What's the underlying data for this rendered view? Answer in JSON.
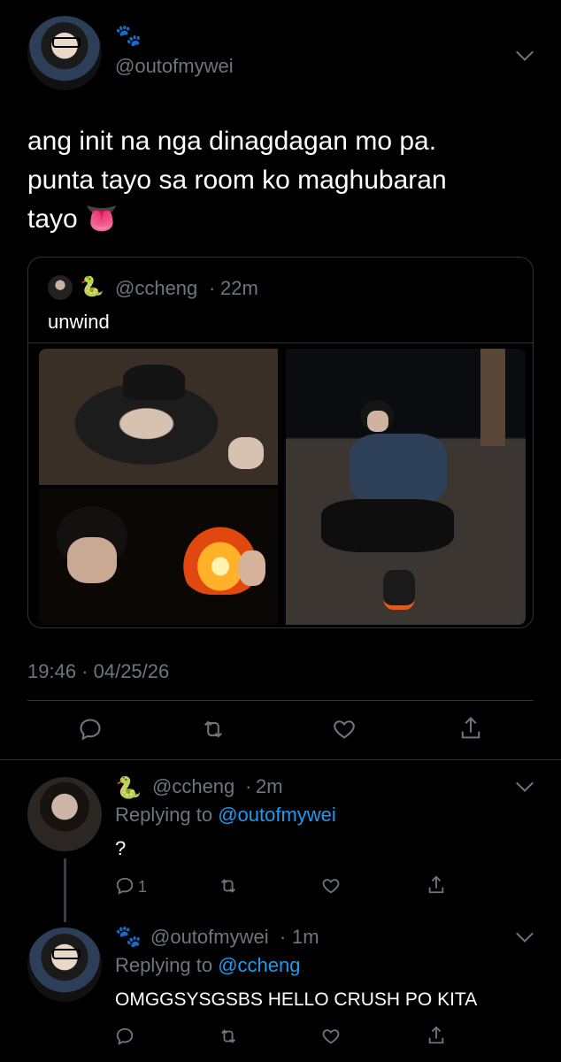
{
  "main_tweet": {
    "name_emoji": "🐾",
    "handle": "@outofmywei",
    "text_line1": "ang init na nga dinagdagan mo pa.",
    "text_line2": "punta tayo sa room ko maghubaran",
    "text_line3": "tayo",
    "text_emoji": "👅",
    "timestamp": "19:46 · 04/25/26"
  },
  "quoted_tweet": {
    "name_emoji": "🐍",
    "handle": "@ccheng",
    "dot": "·",
    "time": "22m",
    "text": "unwind"
  },
  "replies": [
    {
      "name_emoji": "🐍",
      "handle": "@ccheng",
      "dot": "·",
      "time": "2m",
      "replying_prefix": "Replying to ",
      "replying_to": "@outofmywei",
      "text": "?",
      "reply_count": "1"
    },
    {
      "name_emoji": "🐾",
      "handle": "@outofmywei",
      "dot": "·",
      "time": "1m",
      "replying_prefix": "Replying to ",
      "replying_to": "@ccheng",
      "text": "OMGGSYSGSBS HELLO CRUSH PO KITA"
    }
  ],
  "colors": {
    "background": "#000000",
    "text": "#ffffff",
    "muted": "#6e767d",
    "link": "#1d9bf0",
    "divider": "#2f3336"
  },
  "icons": [
    "reply-icon",
    "retweet-icon",
    "like-icon",
    "share-icon",
    "chevron-down-icon"
  ]
}
